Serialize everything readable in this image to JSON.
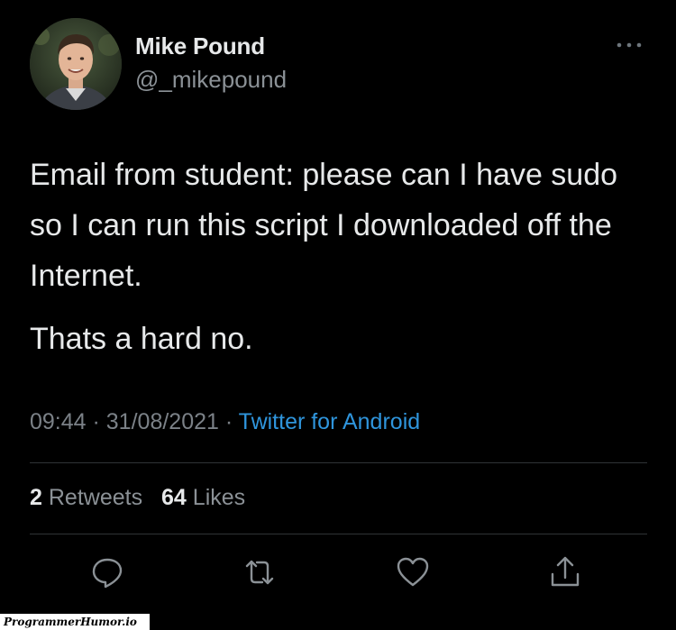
{
  "author": {
    "name": "Mike Pound",
    "handle": "@_mikepound"
  },
  "tweet": {
    "text": "Email from student: please can I have sudo so I can run this script I downloaded off the Internet.",
    "text2": "Thats a hard no.",
    "time": "09:44",
    "date": "31/08/2021",
    "separator": " · ",
    "source": "Twitter for Android"
  },
  "stats": {
    "retweets_count": "2",
    "retweets_label": "Retweets",
    "likes_count": "64",
    "likes_label": "Likes"
  },
  "actions": [
    {
      "name": "reply",
      "icon": "reply-icon"
    },
    {
      "name": "retweet",
      "icon": "retweet-icon"
    },
    {
      "name": "like",
      "icon": "heart-icon"
    },
    {
      "name": "share",
      "icon": "share-icon"
    }
  ],
  "watermark": "ProgrammerHumor.io",
  "colors": {
    "background": "#000000",
    "text": "#e7e9ea",
    "muted": "#8b9196",
    "link": "#2f95dc",
    "divider": "#2f3336"
  }
}
